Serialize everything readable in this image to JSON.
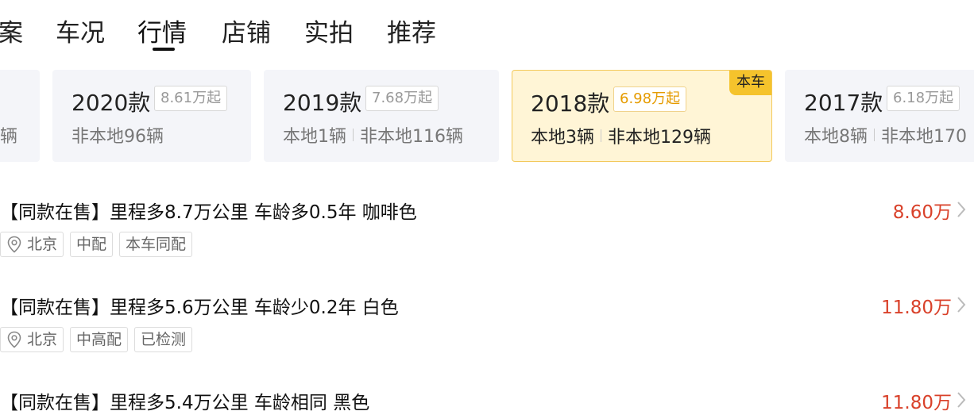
{
  "tabs": [
    {
      "label": "案"
    },
    {
      "label": "车况"
    },
    {
      "label": "行情",
      "active": true
    },
    {
      "label": "店铺"
    },
    {
      "label": "实拍"
    },
    {
      "label": "推荐"
    }
  ],
  "cards": [
    {
      "year": "",
      "price": "",
      "local": "",
      "nonlocal": "辆"
    },
    {
      "year": "2020款",
      "price": "8.61万起",
      "local": "",
      "nonlocal": "非本地96辆"
    },
    {
      "year": "2019款",
      "price": "7.68万起",
      "local": "本地1辆",
      "nonlocal": "非本地116辆"
    },
    {
      "year": "2018款",
      "price": "6.98万起",
      "local": "本地3辆",
      "nonlocal": "非本地129辆",
      "badge": "本车",
      "active": true
    },
    {
      "year": "2017款",
      "price": "6.18万起",
      "local": "本地8辆",
      "nonlocal": "非本地170"
    }
  ],
  "listings": [
    {
      "title": "【同款在售】里程多8.7万公里 车龄多0.5年 咖啡色",
      "price": "8.60万",
      "tags": [
        "北京",
        "中配",
        "本车同配"
      ]
    },
    {
      "title": "【同款在售】里程多5.6万公里 车龄少0.2年 白色",
      "price": "11.80万",
      "tags": [
        "北京",
        "中高配",
        "已检测"
      ]
    },
    {
      "title": "【同款在售】里程多5.4万公里 车龄相同 黑色",
      "price": "11.80万",
      "tags": []
    }
  ],
  "icons": {
    "location": "location-pin-icon",
    "chevron": "chevron-right-icon"
  },
  "colors": {
    "price": "#d9412a",
    "accent": "#f5c32c",
    "active_card_bg": "#fff5d6"
  }
}
